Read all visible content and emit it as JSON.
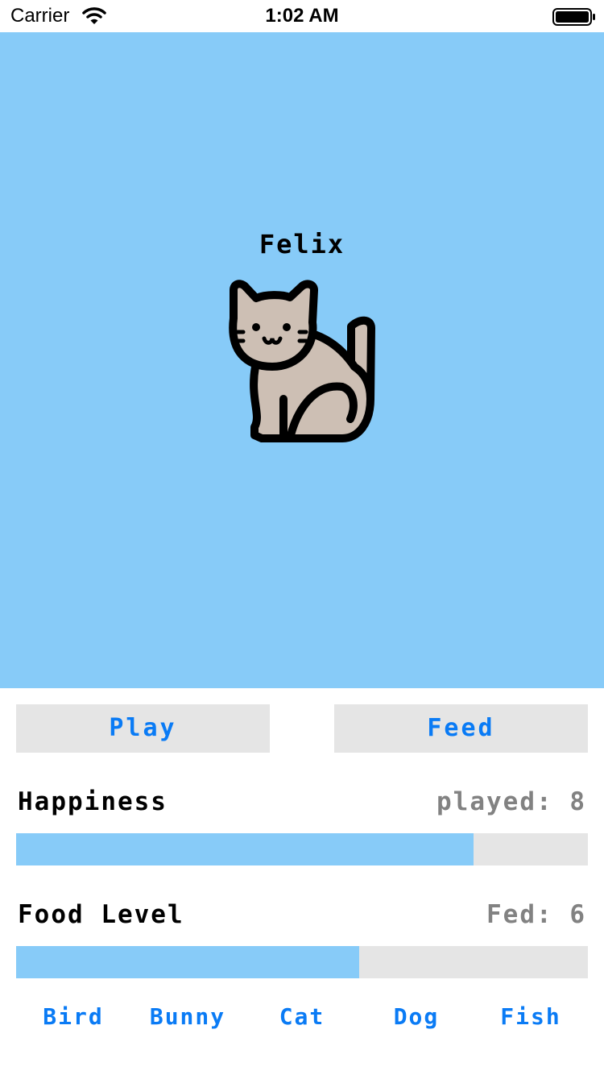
{
  "status_bar": {
    "carrier": "Carrier",
    "time": "1:02 AM",
    "wifi_icon": "wifi-icon",
    "battery_icon": "battery-icon"
  },
  "pet": {
    "name": "Felix",
    "image_icon": "cat-icon",
    "background_color": "#87cbf8"
  },
  "actions": {
    "play_label": "Play",
    "feed_label": "Feed"
  },
  "happiness": {
    "label": "Happiness",
    "count_text": "played: 8",
    "level_fraction": 0.8
  },
  "food": {
    "label": "Food Level",
    "count_text": "Fed: 6",
    "level_fraction": 0.6
  },
  "pet_tabs": [
    "Bird",
    "Bunny",
    "Cat",
    "Dog",
    "Fish"
  ],
  "colors": {
    "accent": "#0a7bf5",
    "bar_fill": "#87cbf8",
    "bar_track": "#e5e5e5",
    "muted_text": "#828282"
  }
}
